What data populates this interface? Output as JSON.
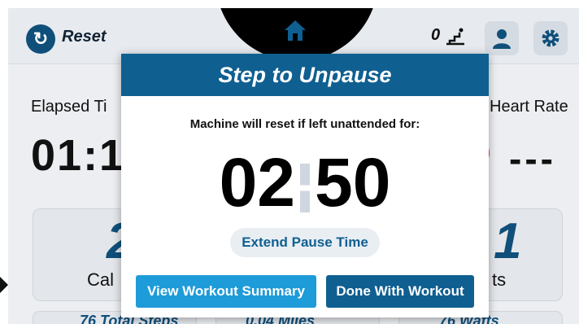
{
  "topbar": {
    "reset_label": "Reset",
    "step_counter": "0",
    "icons": [
      "reset-icon",
      "home-icon",
      "stairs-icon",
      "user-icon",
      "gear-icon"
    ]
  },
  "stats": {
    "elapsed_label": "Elapsed Ti",
    "elapsed_value": "01:1",
    "heart_rate_label": "Heart Rate",
    "heart_rate_value": "---"
  },
  "cards": {
    "left_big": "2",
    "left_label": "Cal",
    "right_big": "1",
    "right_label": "ts"
  },
  "bottom": {
    "steps": "76 Total Steps",
    "miles": "0.04 Miles",
    "watts": "76 Watts"
  },
  "modal": {
    "title": "Step to Unpause",
    "message": "Machine will reset if left unattended for:",
    "timer_minutes": "02",
    "timer_seconds": "50",
    "extend_label": "Extend Pause Time",
    "summary_label": "View Workout Summary",
    "done_label": "Done With Workout"
  },
  "colors": {
    "primary": "#0f5f91",
    "accent": "#1e9bd9",
    "heart": "#e0395a"
  }
}
